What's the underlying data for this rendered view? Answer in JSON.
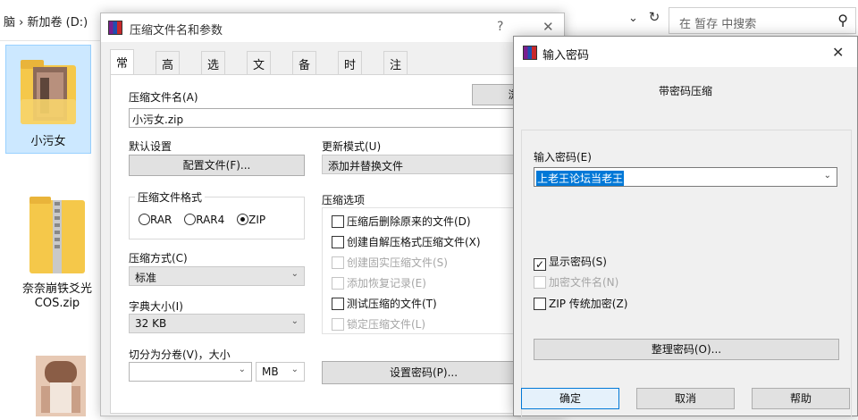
{
  "explorer": {
    "breadcrumb_left": "脑",
    "breadcrumb_sep": "›",
    "breadcrumb": "新加卷 (D:)",
    "search_placeholder": "在 暂存 中搜索",
    "files": [
      {
        "name": "小污女"
      },
      {
        "name": "奈奈崩铁爻光COS.zip"
      },
      {
        "name": ""
      }
    ]
  },
  "main_dialog": {
    "title": "压缩文件名和参数",
    "title_help": "?",
    "title_close": "✕",
    "tabs": [
      "常规",
      "高级",
      "选项",
      "文件",
      "备份",
      "时间",
      "注释"
    ],
    "active_tab": 0,
    "archive_name_label": "压缩文件名(A)",
    "archive_name_value": "小污女.zip",
    "browse_button": "浏览(",
    "default_settings_label": "默认设置",
    "profiles_button": "配置文件(F)...",
    "update_mode_label": "更新模式(U)",
    "update_mode_value": "添加并替换文件",
    "format_group_label": "压缩文件格式",
    "formats": [
      "RAR",
      "RAR4",
      "ZIP"
    ],
    "selected_format": "ZIP",
    "method_label": "压缩方式(C)",
    "method_value": "标准",
    "dict_label": "字典大小(I)",
    "dict_value": "32 KB",
    "split_label": "切分为分卷(V)，大小",
    "split_value": "",
    "split_unit": "MB",
    "options_group_label": "压缩选项",
    "options": [
      {
        "label": "压缩后删除原来的文件(D)",
        "checked": false,
        "disabled": false
      },
      {
        "label": "创建自解压格式压缩文件(X)",
        "checked": false,
        "disabled": false
      },
      {
        "label": "创建固实压缩文件(S)",
        "checked": false,
        "disabled": true
      },
      {
        "label": "添加恢复记录(E)",
        "checked": false,
        "disabled": true
      },
      {
        "label": "测试压缩的文件(T)",
        "checked": false,
        "disabled": false
      },
      {
        "label": "锁定压缩文件(L)",
        "checked": false,
        "disabled": true
      }
    ],
    "set_password_button": "设置密码(P)..."
  },
  "password_dialog": {
    "title": "输入密码",
    "close": "✕",
    "subtitle": "带密码压缩",
    "enter_label": "输入密码(E)",
    "password_value": "上老王论坛当老王",
    "show_password": {
      "label": "显示密码(S)",
      "checked": true
    },
    "encrypt_names": {
      "label": "加密文件名(N)",
      "checked": false,
      "disabled": true
    },
    "zip_legacy": {
      "label": "ZIP 传统加密(Z)",
      "checked": false
    },
    "organize_button": "整理密码(O)...",
    "ok_button": "确定",
    "cancel_button": "取消",
    "help_button": "帮助"
  },
  "colors": {
    "selection": "#0078d7",
    "dialog_bg": "#f0f0f0",
    "button_bg": "#e1e1e1"
  }
}
